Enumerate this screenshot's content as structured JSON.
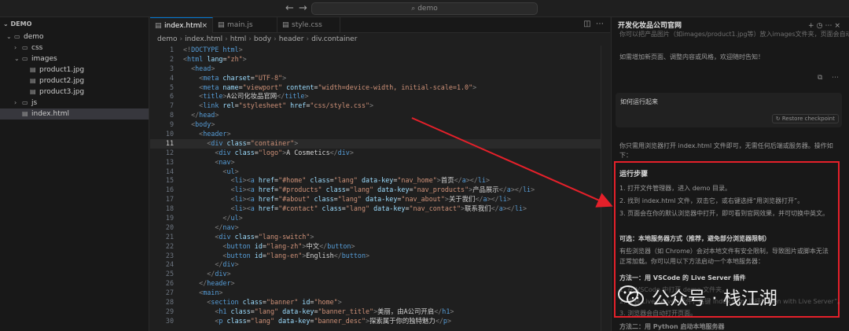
{
  "titlebar": {
    "search": "demo"
  },
  "sidebar": {
    "section": "DEMO",
    "tree": [
      {
        "label": "demo",
        "kind": "folder-open",
        "depth": 0
      },
      {
        "label": "css",
        "kind": "folder",
        "depth": 1
      },
      {
        "label": "images",
        "kind": "folder-open",
        "depth": 1
      },
      {
        "label": "product1.jpg",
        "kind": "file",
        "depth": 2
      },
      {
        "label": "product2.jpg",
        "kind": "file",
        "depth": 2
      },
      {
        "label": "product3.jpg",
        "kind": "file",
        "depth": 2
      },
      {
        "label": "js",
        "kind": "folder",
        "depth": 1
      },
      {
        "label": "index.html",
        "kind": "file",
        "depth": 1,
        "active": true
      }
    ]
  },
  "editor": {
    "tabs": [
      {
        "label": "index.html",
        "active": true,
        "close": "×"
      },
      {
        "label": "main.js",
        "active": false
      },
      {
        "label": "style.css",
        "active": false
      }
    ],
    "breadcrumb": [
      "demo",
      "index.html",
      "html",
      "body",
      "header",
      "div.container"
    ],
    "current_line": 11,
    "lines": [
      {
        "n": "1",
        "t": [
          [
            "<!",
            "p"
          ],
          [
            "DOCTYPE html",
            "d"
          ],
          [
            ">",
            "p"
          ]
        ]
      },
      {
        "n": "2",
        "t": [
          [
            "<",
            "p"
          ],
          [
            "html",
            "g"
          ],
          [
            " lang",
            "a"
          ],
          [
            "=",
            "x"
          ],
          [
            "\"zh\"",
            "s"
          ],
          [
            ">",
            "p"
          ]
        ]
      },
      {
        "n": "3",
        "t": [
          [
            "  <",
            "p"
          ],
          [
            "head",
            "g"
          ],
          [
            ">",
            "p"
          ]
        ]
      },
      {
        "n": "4",
        "t": [
          [
            "    <",
            "p"
          ],
          [
            "meta",
            "g"
          ],
          [
            " charset",
            "a"
          ],
          [
            "=",
            "x"
          ],
          [
            "\"UTF-8\"",
            "s"
          ],
          [
            ">",
            "p"
          ]
        ]
      },
      {
        "n": "5",
        "t": [
          [
            "    <",
            "p"
          ],
          [
            "meta",
            "g"
          ],
          [
            " name",
            "a"
          ],
          [
            "=",
            "x"
          ],
          [
            "\"viewport\"",
            "s"
          ],
          [
            " content",
            "a"
          ],
          [
            "=",
            "x"
          ],
          [
            "\"width=device-width, initial-scale=1.0\"",
            "s"
          ],
          [
            ">",
            "p"
          ]
        ]
      },
      {
        "n": "6",
        "t": [
          [
            "    <",
            "p"
          ],
          [
            "title",
            "g"
          ],
          [
            ">",
            "p"
          ],
          [
            "A公司化妆品官网",
            "x"
          ],
          [
            "</",
            "p"
          ],
          [
            "title",
            "g"
          ],
          [
            ">",
            "p"
          ]
        ]
      },
      {
        "n": "7",
        "t": [
          [
            "    <",
            "p"
          ],
          [
            "link",
            "g"
          ],
          [
            " rel",
            "a"
          ],
          [
            "=",
            "x"
          ],
          [
            "\"stylesheet\"",
            "s"
          ],
          [
            " href",
            "a"
          ],
          [
            "=",
            "x"
          ],
          [
            "\"css/style.css\"",
            "s"
          ],
          [
            ">",
            "p"
          ]
        ]
      },
      {
        "n": "8",
        "t": [
          [
            "  </",
            "p"
          ],
          [
            "head",
            "g"
          ],
          [
            ">",
            "p"
          ]
        ]
      },
      {
        "n": "9",
        "t": [
          [
            "  <",
            "p"
          ],
          [
            "body",
            "g"
          ],
          [
            ">",
            "p"
          ]
        ]
      },
      {
        "n": "10",
        "t": [
          [
            "    <",
            "p"
          ],
          [
            "header",
            "g"
          ],
          [
            ">",
            "p"
          ]
        ]
      },
      {
        "n": "11",
        "t": [
          [
            "      <",
            "p"
          ],
          [
            "div",
            "g"
          ],
          [
            " class",
            "a"
          ],
          [
            "=",
            "x"
          ],
          [
            "\"container\"",
            "s"
          ],
          [
            ">",
            "p"
          ]
        ]
      },
      {
        "n": "12",
        "t": [
          [
            "        <",
            "p"
          ],
          [
            "div",
            "g"
          ],
          [
            " class",
            "a"
          ],
          [
            "=",
            "x"
          ],
          [
            "\"logo\"",
            "s"
          ],
          [
            ">",
            "p"
          ],
          [
            "A Cosmetics",
            "x"
          ],
          [
            "</",
            "p"
          ],
          [
            "div",
            "g"
          ],
          [
            ">",
            "p"
          ]
        ]
      },
      {
        "n": "13",
        "t": [
          [
            "        <",
            "p"
          ],
          [
            "nav",
            "g"
          ],
          [
            ">",
            "p"
          ]
        ]
      },
      {
        "n": "14",
        "t": [
          [
            "          <",
            "p"
          ],
          [
            "ul",
            "g"
          ],
          [
            ">",
            "p"
          ]
        ]
      },
      {
        "n": "15",
        "t": [
          [
            "            <",
            "p"
          ],
          [
            "li",
            "g"
          ],
          [
            "><",
            "p"
          ],
          [
            "a",
            "g"
          ],
          [
            " href",
            "a"
          ],
          [
            "=",
            "x"
          ],
          [
            "\"#home\"",
            "s"
          ],
          [
            " class",
            "a"
          ],
          [
            "=",
            "x"
          ],
          [
            "\"lang\"",
            "s"
          ],
          [
            " data-key",
            "a"
          ],
          [
            "=",
            "x"
          ],
          [
            "\"nav_home\"",
            "s"
          ],
          [
            ">",
            "p"
          ],
          [
            "首页",
            "x"
          ],
          [
            "</",
            "p"
          ],
          [
            "a",
            "g"
          ],
          [
            "></",
            "p"
          ],
          [
            "li",
            "g"
          ],
          [
            ">",
            "p"
          ]
        ]
      },
      {
        "n": "16",
        "t": [
          [
            "            <",
            "p"
          ],
          [
            "li",
            "g"
          ],
          [
            "><",
            "p"
          ],
          [
            "a",
            "g"
          ],
          [
            " href",
            "a"
          ],
          [
            "=",
            "x"
          ],
          [
            "\"#products\"",
            "s"
          ],
          [
            " class",
            "a"
          ],
          [
            "=",
            "x"
          ],
          [
            "\"lang\"",
            "s"
          ],
          [
            " data-key",
            "a"
          ],
          [
            "=",
            "x"
          ],
          [
            "\"nav_products\"",
            "s"
          ],
          [
            ">",
            "p"
          ],
          [
            "产品展示",
            "x"
          ],
          [
            "</",
            "p"
          ],
          [
            "a",
            "g"
          ],
          [
            "></",
            "p"
          ],
          [
            "li",
            "g"
          ],
          [
            ">",
            "p"
          ]
        ]
      },
      {
        "n": "17",
        "t": [
          [
            "            <",
            "p"
          ],
          [
            "li",
            "g"
          ],
          [
            "><",
            "p"
          ],
          [
            "a",
            "g"
          ],
          [
            " href",
            "a"
          ],
          [
            "=",
            "x"
          ],
          [
            "\"#about\"",
            "s"
          ],
          [
            " class",
            "a"
          ],
          [
            "=",
            "x"
          ],
          [
            "\"lang\"",
            "s"
          ],
          [
            " data-key",
            "a"
          ],
          [
            "=",
            "x"
          ],
          [
            "\"nav_about\"",
            "s"
          ],
          [
            ">",
            "p"
          ],
          [
            "关于我们",
            "x"
          ],
          [
            "</",
            "p"
          ],
          [
            "a",
            "g"
          ],
          [
            "></",
            "p"
          ],
          [
            "li",
            "g"
          ],
          [
            ">",
            "p"
          ]
        ]
      },
      {
        "n": "18",
        "t": [
          [
            "            <",
            "p"
          ],
          [
            "li",
            "g"
          ],
          [
            "><",
            "p"
          ],
          [
            "a",
            "g"
          ],
          [
            " href",
            "a"
          ],
          [
            "=",
            "x"
          ],
          [
            "\"#contact\"",
            "s"
          ],
          [
            " class",
            "a"
          ],
          [
            "=",
            "x"
          ],
          [
            "\"lang\"",
            "s"
          ],
          [
            " data-key",
            "a"
          ],
          [
            "=",
            "x"
          ],
          [
            "\"nav_contact\"",
            "s"
          ],
          [
            ">",
            "p"
          ],
          [
            "联系我们",
            "x"
          ],
          [
            "</",
            "p"
          ],
          [
            "a",
            "g"
          ],
          [
            "></",
            "p"
          ],
          [
            "li",
            "g"
          ],
          [
            ">",
            "p"
          ]
        ]
      },
      {
        "n": "19",
        "t": [
          [
            "          </",
            "p"
          ],
          [
            "ul",
            "g"
          ],
          [
            ">",
            "p"
          ]
        ]
      },
      {
        "n": "20",
        "t": [
          [
            "        </",
            "p"
          ],
          [
            "nav",
            "g"
          ],
          [
            ">",
            "p"
          ]
        ]
      },
      {
        "n": "21",
        "t": [
          [
            "        <",
            "p"
          ],
          [
            "div",
            "g"
          ],
          [
            " class",
            "a"
          ],
          [
            "=",
            "x"
          ],
          [
            "\"lang-switch\"",
            "s"
          ],
          [
            ">",
            "p"
          ]
        ]
      },
      {
        "n": "22",
        "t": [
          [
            "          <",
            "p"
          ],
          [
            "button",
            "g"
          ],
          [
            " id",
            "a"
          ],
          [
            "=",
            "x"
          ],
          [
            "\"lang-zh\"",
            "s"
          ],
          [
            ">",
            "p"
          ],
          [
            "中文",
            "x"
          ],
          [
            "</",
            "p"
          ],
          [
            "button",
            "g"
          ],
          [
            ">",
            "p"
          ]
        ]
      },
      {
        "n": "23",
        "t": [
          [
            "          <",
            "p"
          ],
          [
            "button",
            "g"
          ],
          [
            " id",
            "a"
          ],
          [
            "=",
            "x"
          ],
          [
            "\"lang-en\"",
            "s"
          ],
          [
            ">",
            "p"
          ],
          [
            "English",
            "x"
          ],
          [
            "</",
            "p"
          ],
          [
            "button",
            "g"
          ],
          [
            ">",
            "p"
          ]
        ]
      },
      {
        "n": "24",
        "t": [
          [
            "        </",
            "p"
          ],
          [
            "div",
            "g"
          ],
          [
            ">",
            "p"
          ]
        ]
      },
      {
        "n": "25",
        "t": [
          [
            "      </",
            "p"
          ],
          [
            "div",
            "g"
          ],
          [
            ">",
            "p"
          ]
        ]
      },
      {
        "n": "26",
        "t": [
          [
            "    </",
            "p"
          ],
          [
            "header",
            "g"
          ],
          [
            ">",
            "p"
          ]
        ]
      },
      {
        "n": "27",
        "t": [
          [
            "    <",
            "p"
          ],
          [
            "main",
            "g"
          ],
          [
            ">",
            "p"
          ]
        ]
      },
      {
        "n": "28",
        "t": [
          [
            "      <",
            "p"
          ],
          [
            "section",
            "g"
          ],
          [
            " class",
            "a"
          ],
          [
            "=",
            "x"
          ],
          [
            "\"banner\"",
            "s"
          ],
          [
            " id",
            "a"
          ],
          [
            "=",
            "x"
          ],
          [
            "\"home\"",
            "s"
          ],
          [
            ">",
            "p"
          ]
        ]
      },
      {
        "n": "29",
        "t": [
          [
            "        <",
            "p"
          ],
          [
            "h1",
            "g"
          ],
          [
            " class",
            "a"
          ],
          [
            "=",
            "x"
          ],
          [
            "\"lang\"",
            "s"
          ],
          [
            " data-key",
            "a"
          ],
          [
            "=",
            "x"
          ],
          [
            "\"banner_title\"",
            "s"
          ],
          [
            ">",
            "p"
          ],
          [
            "美丽，由A公司开启",
            "x"
          ],
          [
            "</",
            "p"
          ],
          [
            "h1",
            "g"
          ],
          [
            ">",
            "p"
          ]
        ]
      },
      {
        "n": "30",
        "t": [
          [
            "        <",
            "p"
          ],
          [
            "p",
            "g"
          ],
          [
            " class",
            "a"
          ],
          [
            "=",
            "x"
          ],
          [
            "\"lang\"",
            "s"
          ],
          [
            " data-key",
            "a"
          ],
          [
            "=",
            "x"
          ],
          [
            "\"banner_desc\"",
            "s"
          ],
          [
            ">",
            "p"
          ],
          [
            "探索属于你的独特魅力",
            "x"
          ],
          [
            "</",
            "p"
          ],
          [
            "p",
            "g"
          ],
          [
            ">",
            "p"
          ]
        ]
      }
    ]
  },
  "panel": {
    "title": "开发化妆品公司官网",
    "cut_top": "你可以把产品图片（如images/product1.jpg等）放入images文件夹，页面会自动展示。",
    "more": "如需增加新页面、调整内容或风格，欢迎随时告知！",
    "user_msg": "如何运行起来",
    "restore": "Restore checkpoint",
    "intro1": "你只需用浏览器打开 index.html 文件即可，无需任何后端或服务器。操作如",
    "intro2": "下：",
    "steps_title": "运行步骤",
    "steps": [
      "1. 打开文件管理器，进入 demo 目录。",
      "2. 找到 index.html 文件，双击它，或右键选择“用浏览器打开”。",
      "3. 页面会在你的默认浏览器中打开，即可看到官网效果，并可切换中英文。"
    ],
    "optional_title": "可选：本地服务器方式（推荐，避免部分浏览器限制）",
    "optional_desc1": "有些浏览器（如 Chrome）会对本地文件有安全限制，导致图片或脚本无法",
    "optional_desc2": "正常加载。你可以用以下方法启动一个本地服务器：",
    "method1_title": "方法一：用 VSCode 的 Live Server 插件",
    "method1_step1": "1. 在 VSCode 中打开 demo 文件夹。",
    "method1_step2": "2. 安装 Live Server 插件，右键 index.html 选择“Open with Live Server”。",
    "method1_step3": "3. 浏览器会自动打开页面。",
    "method2_cut": "方法二：用 Python 启动本地服务器"
  },
  "watermark": {
    "text": "公众号 · 栈江湖"
  },
  "colors": {
    "accent": "#0078d4",
    "annotation": "#e5202a"
  }
}
